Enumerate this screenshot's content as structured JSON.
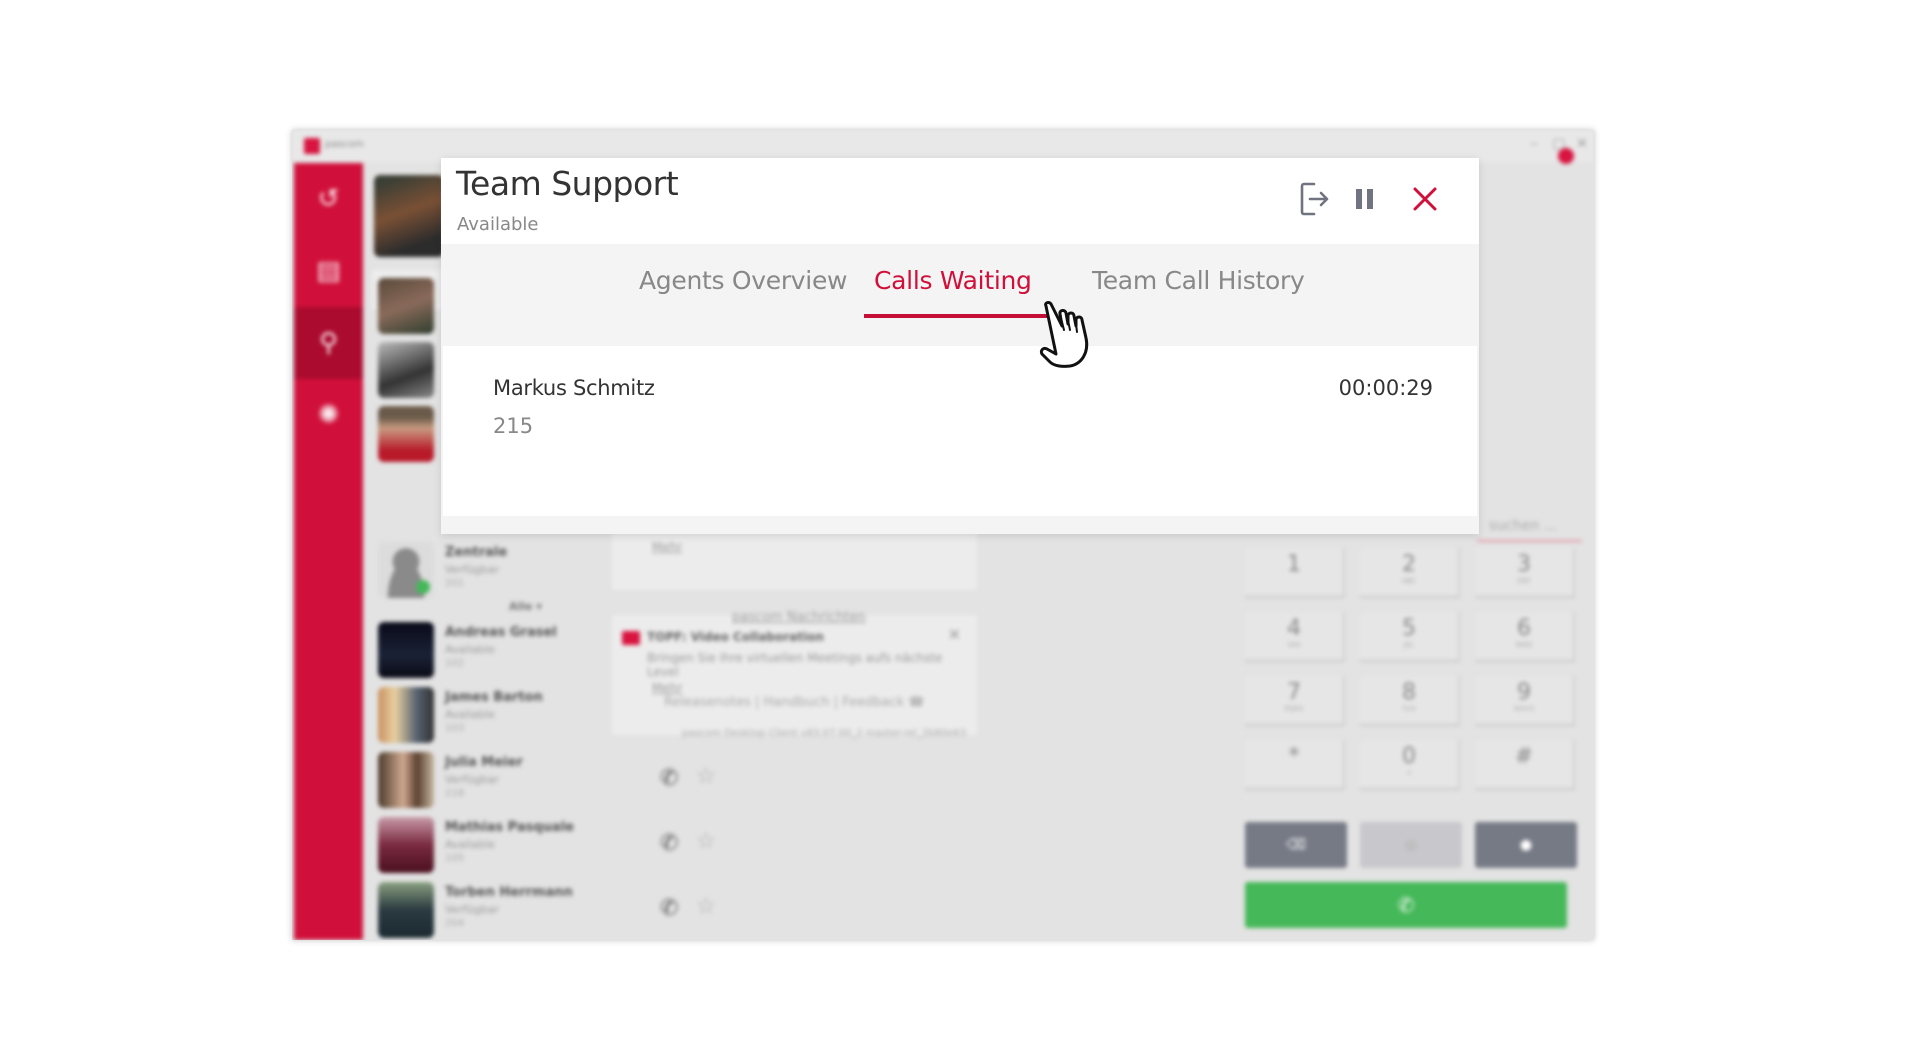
{
  "app": {
    "name": "pascom",
    "window_controls": {
      "minimize": "–",
      "maximize": "▢",
      "close": "✕"
    }
  },
  "sidebar": {
    "items": [
      {
        "name": "history",
        "icon": "history-icon",
        "glyph": "↺",
        "active": false
      },
      {
        "name": "contacts",
        "icon": "contact-card-icon",
        "glyph": "▤",
        "active": false
      },
      {
        "name": "search",
        "icon": "search-icon",
        "glyph": "⚲",
        "active": true
      },
      {
        "name": "settings",
        "icon": "gear-icon",
        "glyph": "✺",
        "active": false
      }
    ]
  },
  "contacts_panel": {
    "search_icon": "⚲",
    "filter_label": "Alle ▾",
    "contacts": [
      {
        "name": "Zentrale",
        "status": "Verfügbar",
        "ext": "201",
        "favorite": true,
        "active_call": true
      },
      {
        "name": "Andreas Grasel",
        "status": "Available",
        "ext": "102",
        "favorite": false,
        "active_call": false
      },
      {
        "name": "James Barton",
        "status": "Available",
        "ext": "103",
        "favorite": false,
        "active_call": false
      },
      {
        "name": "Julia Meier",
        "status": "Verfügbar",
        "ext": "218",
        "favorite": false,
        "active_call": false
      },
      {
        "name": "Mathias Pasquale",
        "status": "Available",
        "ext": "105",
        "favorite": false,
        "active_call": false
      },
      {
        "name": "Torben Herrmann",
        "status": "Verfügbar",
        "ext": "204",
        "favorite": false,
        "active_call": false
      }
    ]
  },
  "news_panel": {
    "card1": {
      "more_label": "Mehr"
    },
    "card2": {
      "title": "TOPF: Video Collaboration",
      "description": "Bringen Sie Ihre virtuellen Meetings aufs nächste Level",
      "more_label": "Mehr",
      "close": "✕"
    },
    "news_link": "pascom Nachrichten",
    "footer_links": "Releasenotes  |  Handbuch  |  Feedback ☎",
    "version": "pascom Desktop Client v83.07.00_2 master-rel_2b80e63"
  },
  "dialpad": {
    "search_placeholder": "suchen ...",
    "keys": [
      {
        "digit": "1",
        "letters": ""
      },
      {
        "digit": "2",
        "letters": "ABC"
      },
      {
        "digit": "3",
        "letters": "DEF"
      },
      {
        "digit": "4",
        "letters": "GHI"
      },
      {
        "digit": "5",
        "letters": "JKL"
      },
      {
        "digit": "6",
        "letters": "MNO"
      },
      {
        "digit": "7",
        "letters": "PQRS"
      },
      {
        "digit": "8",
        "letters": "TUV"
      },
      {
        "digit": "9",
        "letters": "WXYZ"
      },
      {
        "digit": "*",
        "letters": ""
      },
      {
        "digit": "0",
        "letters": "+"
      },
      {
        "digit": "#",
        "letters": ""
      }
    ],
    "action_left": "⌫",
    "action_middle": "◎",
    "action_right": "●",
    "call_glyph": "✆"
  },
  "modal": {
    "title": "Team Support",
    "status": "Available",
    "icons": {
      "leave": "leave-team-icon",
      "pause": "pause-icon",
      "close": "close-icon"
    },
    "tabs": [
      {
        "label": "Agents Overview",
        "active": false
      },
      {
        "label": "Calls Waiting",
        "active": true
      },
      {
        "label": "Team Call History",
        "active": false
      }
    ],
    "calls_waiting": [
      {
        "caller_name": "Markus Schmitz",
        "extension": "215",
        "wait_time": "00:00:29"
      }
    ]
  },
  "colors": {
    "brand_red": "#d0103a",
    "active_sidebar": "#a80b2e",
    "call_green": "#45b859",
    "icon_gray": "#6f7480",
    "tab_inactive": "#888888"
  }
}
